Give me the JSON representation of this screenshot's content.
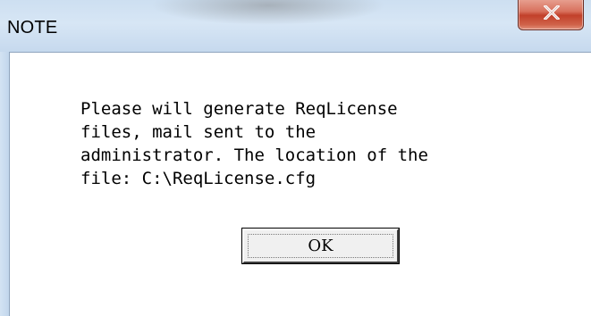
{
  "window": {
    "title": "NOTE"
  },
  "titlebar": {
    "close_icon": "close-icon"
  },
  "dialog": {
    "message": "Please will generate ReqLicense\nfiles, mail sent to the\nadministrator. The location of the\nfile: C:\\ReqLicense.cfg",
    "ok_label": "OK"
  },
  "colors": {
    "close_button": "#c7452e",
    "titlebar": "#cddff1",
    "client_background": "#ffffff"
  }
}
